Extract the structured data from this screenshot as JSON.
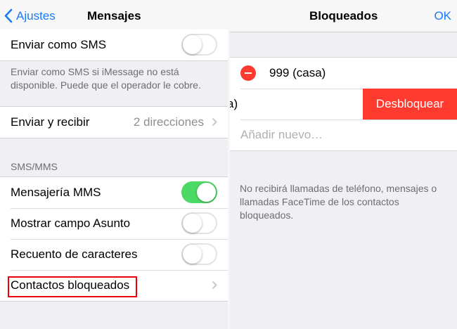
{
  "left": {
    "nav": {
      "back_label": "Ajustes",
      "title": "Mensajes"
    },
    "send_sms": {
      "label": "Enviar como SMS",
      "on": false
    },
    "send_sms_footnote": "Enviar como SMS si iMessage no está disponible. Puede que el operador le cobre.",
    "send_receive": {
      "label": "Enviar y recibir",
      "detail": "2 direcciones"
    },
    "section_header": "SMS/MMS",
    "mms": {
      "label": "Mensajería MMS",
      "on": true
    },
    "subject": {
      "label": "Mostrar campo Asunto",
      "on": false
    },
    "char_count": {
      "label": "Recuento de caracteres",
      "on": false
    },
    "blocked": {
      "label": "Contactos bloqueados"
    }
  },
  "right": {
    "nav": {
      "title": "Bloqueados",
      "ok_label": "OK"
    },
    "contacts": [
      "999 (casa)",
      "a)"
    ],
    "unblock_label": "Desbloquear",
    "add_new": "Añadir nuevo…",
    "footnote": "No recibirá llamadas de teléfono, mensajes o llamadas FaceTime de los contactos bloqueados."
  },
  "colors": {
    "accent": "#1a7bf5",
    "toggle_on": "#4cd964",
    "destructive": "#ff3b30",
    "highlight_box": "#e8000b"
  }
}
